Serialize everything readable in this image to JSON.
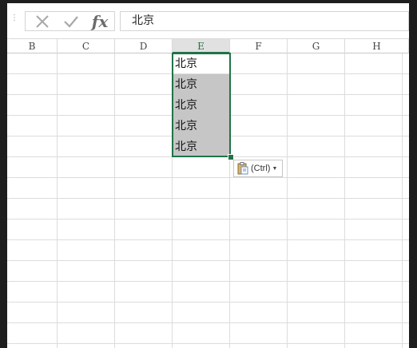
{
  "formula_bar": {
    "cancel_icon": "x-icon",
    "enter_icon": "checkmark-icon",
    "function_label": "fx",
    "content": "北京"
  },
  "columns": [
    {
      "label": "B",
      "selected": false
    },
    {
      "label": "C",
      "selected": false
    },
    {
      "label": "D",
      "selected": false
    },
    {
      "label": "E",
      "selected": true
    },
    {
      "label": "F",
      "selected": false
    },
    {
      "label": "G",
      "selected": false
    },
    {
      "label": "H",
      "selected": false
    }
  ],
  "cells": [
    {
      "value": "北京",
      "filled": false
    },
    {
      "value": "北京",
      "filled": true
    },
    {
      "value": "北京",
      "filled": true
    },
    {
      "value": "北京",
      "filled": true
    },
    {
      "value": "北京",
      "filled": true
    }
  ],
  "paste_options": {
    "label": "(Ctrl)",
    "icon": "clipboard-icon"
  },
  "colors": {
    "accent": "#217346",
    "selection_fill": "#c6c6c6",
    "gridline": "#dcdcdc"
  }
}
